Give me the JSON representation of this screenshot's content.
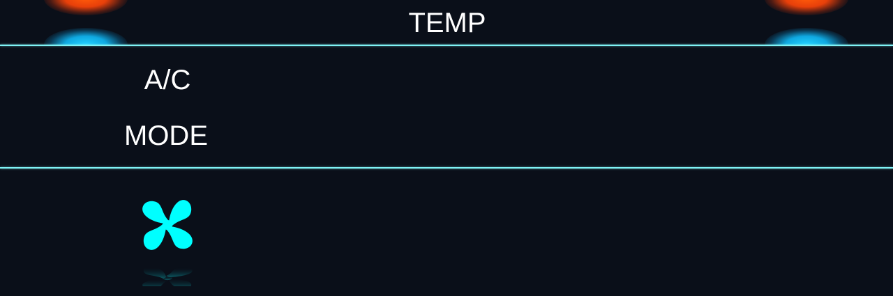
{
  "climate": {
    "temp_label": "TEMP",
    "ac_label": "A/C",
    "mode_label": "MODE"
  },
  "icons": {
    "fan": "fan-icon"
  },
  "colors": {
    "background": "#0a0f19",
    "divider": "#7ff3f6",
    "fan": "#00ffff",
    "heat": "#ff5a0a",
    "cool": "#22d0ff",
    "text": "#ffffff"
  }
}
